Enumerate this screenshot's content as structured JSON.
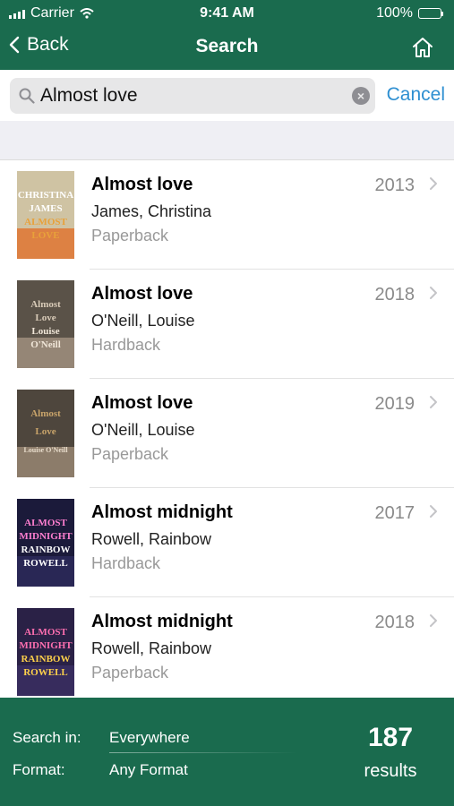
{
  "status": {
    "carrier": "Carrier",
    "time": "9:41 AM",
    "battery": "100%"
  },
  "nav": {
    "back_label": "Back",
    "title": "Search"
  },
  "search": {
    "value": "Almost love",
    "cancel_label": "Cancel"
  },
  "results": [
    {
      "title": "Almost love",
      "author": "James, Christina",
      "format": "Paperback",
      "year": "2013",
      "cover": {
        "bg": "#cfc3a3",
        "accent": "#e0702b",
        "lines": [
          "CHRISTINA",
          "JAMES",
          "ALMOST",
          "LOVE"
        ],
        "colors": [
          "#ffffff",
          "#ffffff",
          "#e8a13a",
          "#e8a13a"
        ]
      }
    },
    {
      "title": "Almost love",
      "author": "O'Neill, Louise",
      "format": "Hardback",
      "year": "2018",
      "cover": {
        "bg": "#5a5248",
        "accent": "#a49482",
        "lines": [
          "Almost",
          "Love",
          "Louise",
          "O'Neill"
        ],
        "colors": [
          "#d9cbb8",
          "#d9cbb8",
          "#f0e6d8",
          "#f0e6d8"
        ]
      }
    },
    {
      "title": "Almost love",
      "author": "O'Neill, Louise",
      "format": "Paperback",
      "year": "2019",
      "cover": {
        "bg": "#4e463d",
        "accent": "#9c8a76",
        "lines": [
          "Almost",
          "Love",
          "Louise O'Neill"
        ],
        "colors": [
          "#c9a46a",
          "#c9a46a",
          "#e8dccb"
        ]
      }
    },
    {
      "title": "Almost midnight",
      "author": "Rowell, Rainbow",
      "format": "Hardback",
      "year": "2017",
      "cover": {
        "bg": "#1b1a3a",
        "accent": "#2d2a5c",
        "lines": [
          "ALMOST",
          "MIDNIGHT",
          "RAINBOW",
          "ROWELL"
        ],
        "colors": [
          "#ff7fd0",
          "#ff7fd0",
          "#ffffff",
          "#ffffff"
        ]
      }
    },
    {
      "title": "Almost midnight",
      "author": "Rowell, Rainbow",
      "format": "Paperback",
      "year": "2018",
      "cover": {
        "bg": "#2a2146",
        "accent": "#3b2f63",
        "lines": [
          "ALMOST",
          "MIDNIGHT",
          "RAINBOW",
          "ROWELL"
        ],
        "colors": [
          "#ff6fb0",
          "#ff6fb0",
          "#ffd24a",
          "#ffd24a"
        ]
      }
    }
  ],
  "footer": {
    "search_in_label": "Search in:",
    "search_in_value": "Everywhere",
    "format_label": "Format:",
    "format_value": "Any Format",
    "count": "187",
    "count_label": "results"
  },
  "colors": {
    "brand_green": "#1a6b4e",
    "link_blue": "#2e8fd1"
  },
  "icons": {
    "back": "chevron-left-icon",
    "home": "home-icon",
    "search": "search-icon",
    "clear": "clear-icon",
    "row": "chevron-right-icon"
  }
}
